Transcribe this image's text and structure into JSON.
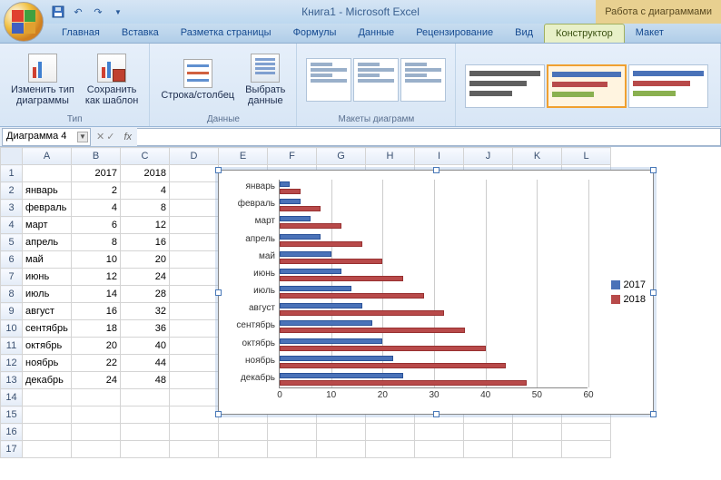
{
  "title": "Книга1 - Microsoft Excel",
  "tool_context": "Работа с диаграммами",
  "tabs": {
    "items": [
      "Главная",
      "Вставка",
      "Разметка страницы",
      "Формулы",
      "Данные",
      "Рецензирование",
      "Вид",
      "Конструктор",
      "Макет"
    ],
    "active_index": 7
  },
  "ribbon": {
    "group_type": {
      "label": "Тип",
      "change_type": "Изменить тип\nдиаграммы",
      "save_template": "Сохранить\nкак шаблон"
    },
    "group_data": {
      "label": "Данные",
      "swap": "Строка/столбец",
      "select": "Выбрать\nданные"
    },
    "group_layouts": {
      "label": "Макеты диаграмм"
    }
  },
  "namebox": "Диаграмма 4",
  "columns": [
    "A",
    "B",
    "C",
    "D",
    "E",
    "F",
    "G",
    "H",
    "I",
    "J",
    "K",
    "L"
  ],
  "rows_shown": 17,
  "sheet": {
    "header_years": {
      "b": 2017,
      "c": 2018
    },
    "rows": [
      {
        "label": "январь",
        "a": 2,
        "b": 4
      },
      {
        "label": "февраль",
        "a": 4,
        "b": 8
      },
      {
        "label": "март",
        "a": 6,
        "b": 12
      },
      {
        "label": "апрель",
        "a": 8,
        "b": 16
      },
      {
        "label": "май",
        "a": 10,
        "b": 20
      },
      {
        "label": "июнь",
        "a": 12,
        "b": 24
      },
      {
        "label": "июль",
        "a": 14,
        "b": 28
      },
      {
        "label": "август",
        "a": 16,
        "b": 32
      },
      {
        "label": "сентябрь",
        "a": 18,
        "b": 36
      },
      {
        "label": "октябрь",
        "a": 20,
        "b": 40
      },
      {
        "label": "ноябрь",
        "a": 22,
        "b": 44
      },
      {
        "label": "декабрь",
        "a": 24,
        "b": 48
      }
    ]
  },
  "chart_data": {
    "type": "bar",
    "categories": [
      "январь",
      "февраль",
      "март",
      "апрель",
      "май",
      "июнь",
      "июль",
      "август",
      "сентябрь",
      "октябрь",
      "ноябрь",
      "декабрь"
    ],
    "series": [
      {
        "name": "2017",
        "color": "#4a72b8",
        "values": [
          2,
          4,
          6,
          8,
          10,
          12,
          14,
          16,
          18,
          20,
          22,
          24
        ]
      },
      {
        "name": "2018",
        "color": "#b84a4a",
        "values": [
          4,
          8,
          12,
          16,
          20,
          24,
          28,
          32,
          36,
          40,
          44,
          48
        ]
      }
    ],
    "xlim": [
      0,
      60
    ],
    "xticks": [
      0,
      10,
      20,
      30,
      40,
      50,
      60
    ],
    "title": "",
    "xlabel": "",
    "ylabel": ""
  }
}
